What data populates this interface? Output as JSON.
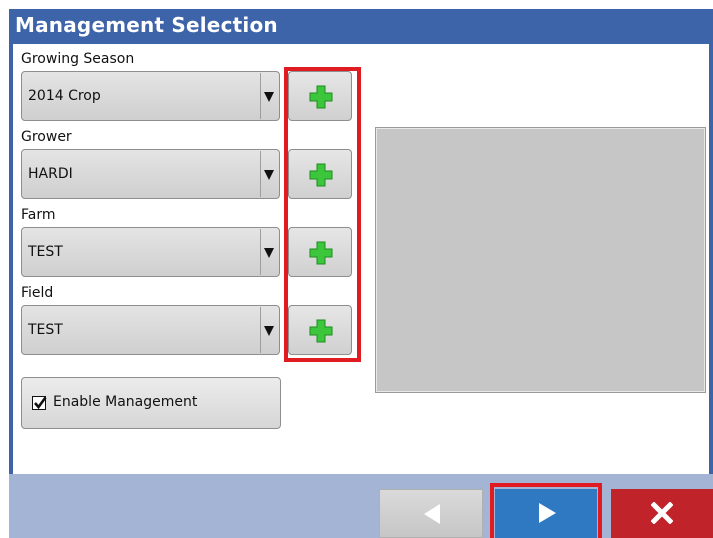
{
  "window": {
    "title": "Management Selection"
  },
  "fields": [
    {
      "label": "Growing Season",
      "value": "2014 Crop"
    },
    {
      "label": "Grower",
      "value": "HARDI"
    },
    {
      "label": "Farm",
      "value": "TEST"
    },
    {
      "label": "Field",
      "value": "TEST"
    }
  ],
  "enable_management": {
    "label": "Enable Management",
    "checked": true
  },
  "colors": {
    "title_bar": "#3d63a8",
    "add_icon": "#3cc63c",
    "next_button": "#2f79c3",
    "cancel_button": "#c0232a",
    "highlight": "#e11b22"
  },
  "icons": {
    "add": "plus-icon",
    "back": "triangle-left-icon",
    "next": "triangle-right-icon",
    "cancel": "x-icon"
  }
}
